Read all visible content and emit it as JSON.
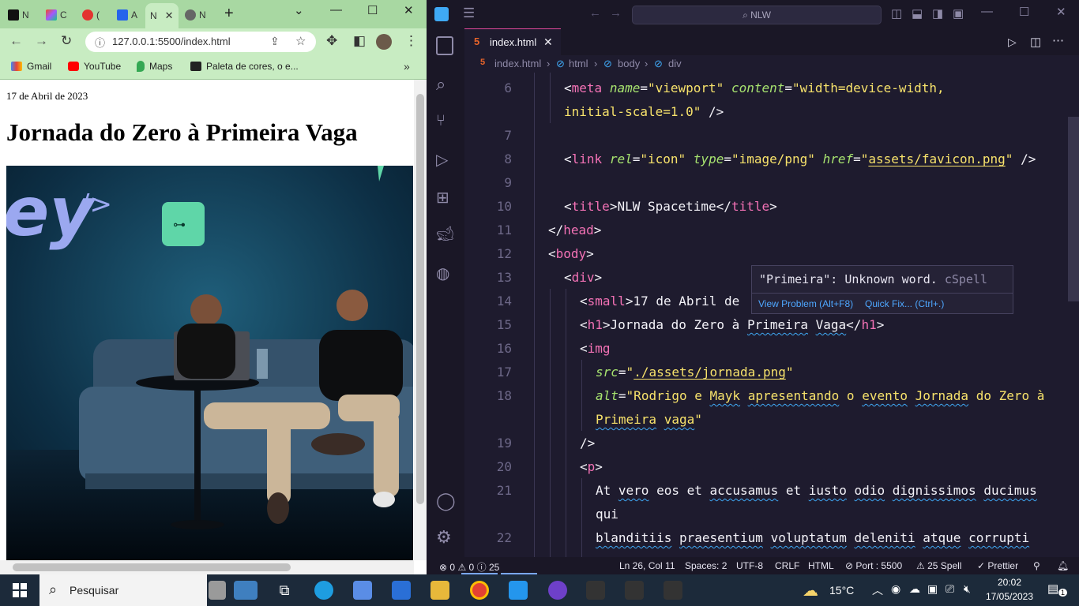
{
  "browser": {
    "tabs": [
      {
        "title": "N"
      },
      {
        "title": "C"
      },
      {
        "title": "("
      },
      {
        "title": "A"
      },
      {
        "title": "N",
        "active": true
      },
      {
        "title": "N"
      }
    ],
    "url": "127.0.0.1:5500/index.html",
    "bookmarks": [
      {
        "label": "Gmail"
      },
      {
        "label": "YouTube"
      },
      {
        "label": "Maps"
      },
      {
        "label": "Paleta de cores, o e..."
      }
    ],
    "page": {
      "date": "17 de Abril de 2023",
      "heading": "Jornada do Zero à Primeira Vaga"
    }
  },
  "vscode": {
    "search": "NLW",
    "tab_label": "index.html",
    "breadcrumb": [
      "index.html",
      "html",
      "body",
      "div"
    ],
    "hover": {
      "message": "\"Primeira\": Unknown word.",
      "source": "cSpell",
      "action_view": "View Problem (Alt+F8)",
      "action_fix": "Quick Fix... (Ctrl+.)"
    },
    "line_numbers": [
      "6",
      "7",
      "8",
      "9",
      "10",
      "11",
      "12",
      "13",
      "14",
      "15",
      "16",
      "17",
      "18",
      "19",
      "20",
      "21",
      "22"
    ],
    "status": {
      "errors": "0",
      "warnings": "0",
      "info": "25",
      "position": "Ln 26, Col 11",
      "spaces": "Spaces: 2",
      "encoding": "UTF-8",
      "eol": "CRLF",
      "language": "HTML",
      "port": "Port : 5500",
      "spell": "25 Spell",
      "prettier": "Prettier"
    }
  },
  "taskbar": {
    "search_label": "Pesquisar",
    "weather": "15°C",
    "time": "20:02",
    "date": "17/05/2023",
    "notifications": "1"
  },
  "colors": {
    "browser_tabstrip": "#a8d8a2",
    "vscode_bg": "#1e1b2e",
    "tag": "#f472b6",
    "attr": "#a7e36f",
    "string": "#f7e26b"
  }
}
